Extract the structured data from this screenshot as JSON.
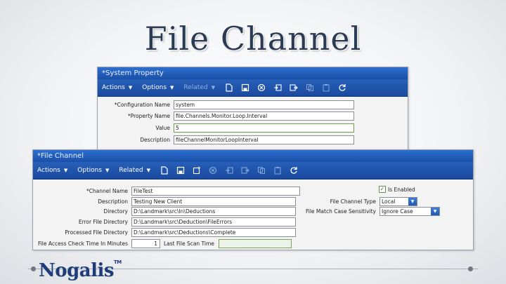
{
  "slide": {
    "title": "File Channel",
    "logo_text": "Nogalis",
    "logo_tm": "TM"
  },
  "system_property": {
    "window_title": "*System Property",
    "menus": [
      {
        "label": "Actions",
        "enabled": true
      },
      {
        "label": "Options",
        "enabled": true
      },
      {
        "label": "Related",
        "enabled": false
      }
    ],
    "icons": [
      "new-icon",
      "save-icon",
      "delete-icon",
      "import-icon",
      "export-icon",
      "copy-icon",
      "paste-icon",
      "refresh-icon"
    ],
    "fields": {
      "configuration_name": {
        "label": "*Configuration Name",
        "value": "system"
      },
      "property_name": {
        "label": "*Property Name",
        "value": "file.Channels.Monitor.Loop.Interval"
      },
      "value": {
        "label": "Value",
        "value": "5"
      },
      "description": {
        "label": "Description",
        "value": "fileChannelMonitorLoopInterval"
      }
    }
  },
  "file_channel": {
    "window_title": "*File Channel",
    "menus": [
      {
        "label": "Actions",
        "enabled": true
      },
      {
        "label": "Options",
        "enabled": true
      },
      {
        "label": "Related",
        "enabled": true
      }
    ],
    "fields": {
      "channel_name": {
        "label": "*Channel Name",
        "value": "FileTest"
      },
      "description": {
        "label": "Description",
        "value": "Testing New Client"
      },
      "directory": {
        "label": "Directory",
        "value": "D:\\Landmark\\src\\In\\Deductions"
      },
      "error_file_directory": {
        "label": "Error File Directory",
        "value": "D:\\Landmark\\src\\Deduction\\FileErrors"
      },
      "processed_file_directory": {
        "label": "Processed File Directory",
        "value": "D:\\Landmark\\src\\Deductions\\Complete"
      },
      "file_access_check_time": {
        "label": "File Access Check Time In Minutes",
        "value": "1"
      },
      "last_file_scan_time": {
        "label": "Last File Scan Time",
        "value": ""
      },
      "is_enabled": {
        "label": "Is Enabled",
        "checked": true
      },
      "file_channel_type": {
        "label": "File Channel Type",
        "value": "Local"
      },
      "file_match_case_sensitivity": {
        "label": "File Match Case Sensitivity",
        "value": "Ignore Case"
      }
    }
  },
  "colors": {
    "toolbar_blue": "#1a4a9e",
    "title_navy": "#2b3a55",
    "logo_blue": "#1d3c78"
  }
}
